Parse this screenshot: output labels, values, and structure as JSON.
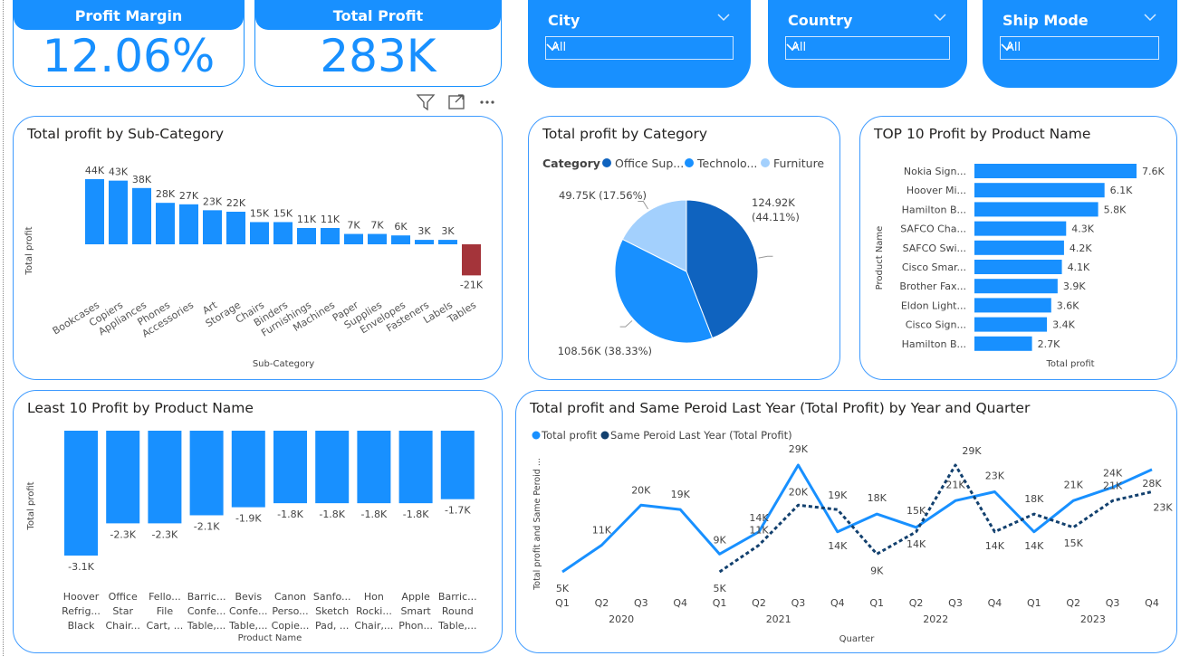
{
  "kpis": {
    "profit_margin": {
      "label": "Profit Margin",
      "value": "12.06%"
    },
    "total_profit": {
      "label": "Total Profit",
      "value": "283K"
    }
  },
  "slicers": [
    {
      "label": "City",
      "value": "All"
    },
    {
      "label": "Country",
      "value": "All"
    },
    {
      "label": "Ship Mode",
      "value": "All"
    }
  ],
  "colors": {
    "accent": "#1890ff",
    "negative": "#a4343a",
    "dark_series": "#12406e",
    "light_slice": "#a3d0fd"
  },
  "icons": {
    "filter": "filter-icon",
    "focus": "focus-mode-icon",
    "more": "more-options-icon"
  },
  "chart_data": [
    {
      "id": "subcat",
      "type": "bar",
      "title": "Total profit by Sub-Category",
      "xlabel": "Sub-Category",
      "ylabel": "Total profit",
      "categories": [
        "Bookcases",
        "Copiers",
        "Appliances",
        "Phones",
        "Accessories",
        "Art",
        "Storage",
        "Chairs",
        "Binders",
        "Furnishings",
        "Machines",
        "Paper",
        "Supplies",
        "Envelopes",
        "Fasteners",
        "Labels",
        "Tables"
      ],
      "values": [
        44,
        43,
        38,
        28,
        27,
        23,
        22,
        15,
        15,
        11,
        11,
        7,
        7,
        6,
        3,
        3,
        -21
      ],
      "labels": [
        "44K",
        "43K",
        "38K",
        "28K",
        "27K",
        "23K",
        "22K",
        "15K",
        "15K",
        "11K",
        "11K",
        "7K",
        "7K",
        "6K",
        "3K",
        "3K",
        "-21K"
      ]
    },
    {
      "id": "category",
      "type": "pie",
      "title": "Total profit by Category",
      "legend_title": "Category",
      "legend": [
        "Office Sup...",
        "Technolo...",
        "Furniture"
      ],
      "categories": [
        "Office Supplies",
        "Technology",
        "Furniture"
      ],
      "values": [
        124.92,
        108.56,
        49.75
      ],
      "labels": [
        "124.92K (44.11%)",
        "108.56K (38.33%)",
        "49.75K (17.56%)"
      ]
    },
    {
      "id": "top10",
      "type": "bar",
      "title": "TOP 10 Profit by Product Name",
      "xlabel": "Total profit",
      "ylabel": "Product Name",
      "categories": [
        "Nokia Sign...",
        "Hoover Mi...",
        "Hamilton B...",
        "SAFCO Cha...",
        "SAFCO Swi...",
        "Cisco Smar...",
        "Brother Fax...",
        "Eldon Light...",
        "Cisco Sign...",
        "Hamilton B..."
      ],
      "values": [
        7.6,
        6.1,
        5.8,
        4.3,
        4.2,
        4.1,
        3.9,
        3.6,
        3.4,
        2.7
      ],
      "labels": [
        "7.6K",
        "6.1K",
        "5.8K",
        "4.3K",
        "4.2K",
        "4.1K",
        "3.9K",
        "3.6K",
        "3.4K",
        "2.7K"
      ]
    },
    {
      "id": "least10",
      "type": "bar",
      "title": "Least 10 Profit by Product Name",
      "xlabel": "Product Name",
      "ylabel": "Total profit",
      "categories": [
        [
          "Hoover",
          "Refrig...",
          "Black"
        ],
        [
          "Office",
          "Star",
          "Chair..."
        ],
        [
          "Fello...",
          "File",
          "Cart, ..."
        ],
        [
          "Barric...",
          "Confe...",
          "Table,..."
        ],
        [
          "Bevis",
          "Confe...",
          "Table,..."
        ],
        [
          "Canon",
          "Perso...",
          "Copie..."
        ],
        [
          "Sanfo...",
          "Sketch",
          "Pad, ..."
        ],
        [
          "Hon",
          "Rocki...",
          "Chair,..."
        ],
        [
          "Apple",
          "Smart",
          "Phon..."
        ],
        [
          "Barric...",
          "Round",
          "Table,..."
        ]
      ],
      "values": [
        -3.1,
        -2.3,
        -2.3,
        -2.1,
        -1.9,
        -1.8,
        -1.8,
        -1.8,
        -1.8,
        -1.7
      ],
      "labels": [
        "-3.1K",
        "-2.3K",
        "-2.3K",
        "-2.1K",
        "-1.9K",
        "-1.8K",
        "-1.8K",
        "-1.8K",
        "-1.8K",
        "-1.7K"
      ]
    },
    {
      "id": "timeline",
      "type": "line",
      "title": "Total profit and Same Peroid Last Year (Total Profit) by Year and Quarter",
      "xlabel": "Quarter",
      "ylabel": "Total profit and Same Peroid ...",
      "quarters": [
        "Q1",
        "Q2",
        "Q3",
        "Q4",
        "Q1",
        "Q2",
        "Q3",
        "Q4",
        "Q1",
        "Q2",
        "Q3",
        "Q4",
        "Q1",
        "Q2",
        "Q3",
        "Q4"
      ],
      "years": [
        "2020",
        "2021",
        "2022",
        "2023"
      ],
      "series": [
        {
          "name": "Total profit",
          "values": [
            5,
            11,
            20,
            19,
            9,
            14,
            29,
            14,
            18,
            15,
            21,
            23,
            14,
            21,
            24,
            28
          ],
          "labels": [
            "5K",
            "11K",
            "20K",
            "19K",
            "9K",
            "14K",
            "29K",
            "14K",
            "18K",
            "15K",
            "21K",
            "23K",
            "14K",
            "21K",
            "24K",
            "28K"
          ]
        },
        {
          "name": "Same Peroid Last Year (Total Profit)",
          "values": [
            null,
            null,
            null,
            null,
            5,
            11,
            20,
            19,
            9,
            14,
            29,
            14,
            18,
            15,
            21,
            23
          ],
          "labels": [
            "",
            "",
            "",
            "",
            "5K",
            "11K",
            "20K",
            "19K",
            "9K",
            "14K",
            "29K",
            "14K",
            "18K",
            "15K",
            "21K",
            "23K"
          ]
        }
      ]
    }
  ]
}
